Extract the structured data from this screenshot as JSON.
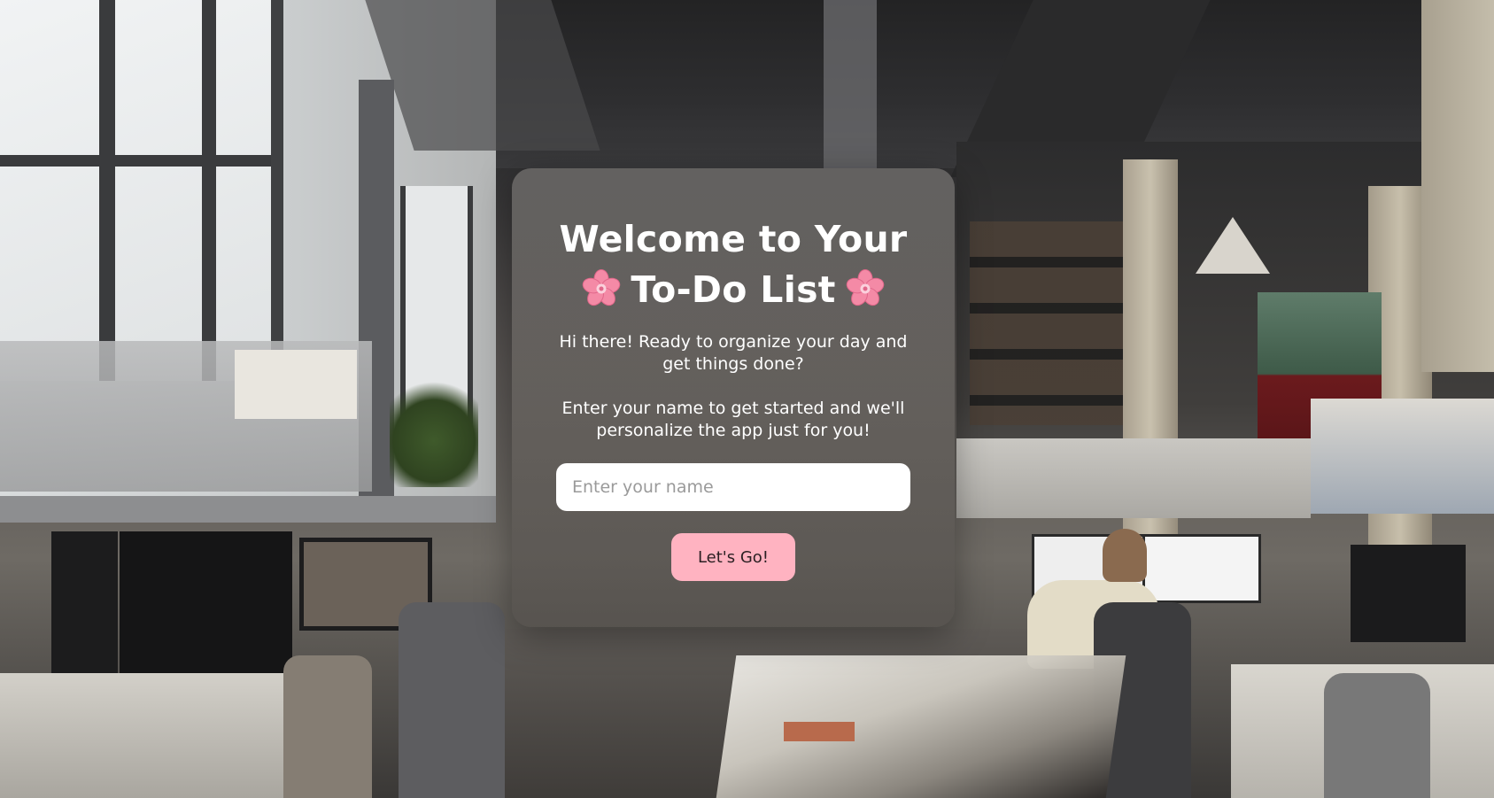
{
  "card": {
    "title_line1": "Welcome to Your",
    "title_line2": "To-Do List",
    "title_icon": "cherry-blossom",
    "intro_text": "Hi there! Ready to organize your day and get things done?",
    "instruction_text": "Enter your name to get started and we'll personalize the app just for you!",
    "name_input": {
      "placeholder": "Enter your name",
      "value": ""
    },
    "submit_label": "Let's Go!"
  },
  "colors": {
    "button_bg": "#ffb3c1",
    "flower": "#f48aa6",
    "card_text": "#ffffff"
  }
}
